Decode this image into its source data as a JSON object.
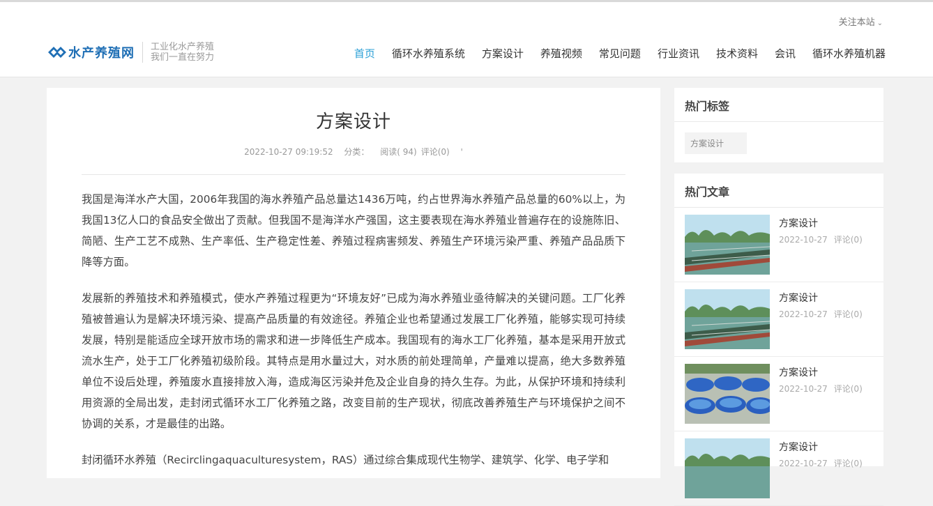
{
  "header": {
    "follow_label": "关注本站",
    "logo_name": "水产养殖网",
    "tagline_1": "工业化水产养殖",
    "tagline_2": "我们一直在努力",
    "nav": [
      "首页",
      "循环水养殖系统",
      "方案设计",
      "养殖视频",
      "常见问题",
      "行业资讯",
      "技术资料",
      "会讯",
      "循环水养殖机器"
    ]
  },
  "article": {
    "title": "方案设计",
    "date": "2022-10-27 09:19:52",
    "category_label": "分类：",
    "reads": "阅读( 94)",
    "comments": "评论(0)",
    "extra": "'",
    "paragraphs": [
      "我国是海洋水产大国，2006年我国的海水养殖产品总量达1436万吨，约占世界海水养殖产品总量的60%以上，为我国13亿人口的食品安全做出了贡献。但我国不是海洋水产强国，这主要表现在海水养殖业普遍存在的设施陈旧、简陋、生产工艺不成熟、生产率低、生产稳定性差、养殖过程病害频发、养殖生产环境污染严重、养殖产品品质下降等方面。",
      "发展新的养殖技术和养殖模式，使水产养殖过程更为“环境友好”已成为海水养殖业亟待解决的关键问题。工厂化养殖被普遍认为是解决环境污染、提高产品质量的有效途径。养殖企业也希望通过发展工厂化养殖，能够实现可持续发展，特别是能适应全球开放市场的需求和进一步降低生产成本。我国现有的海水工厂化养殖，基本是采用开放式流水生产，处于工厂化养殖初级阶段。其特点是用水量过大，对水质的前处理简单，产量难以提高，绝大多数养殖单位不设后处理，养殖废水直接排放入海，造成海区污染并危及企业自身的持久生存。为此，从保护环境和持续利用资源的全局出发，走封闭式循环水工厂化养殖之路，改变目前的生产现状，彻底改善养殖生产与环境保护之间不协调的关系，才是最佳的出路。",
      "封闭循环水养殖（Recirclingaquaculturesystem，RAS）通过综合集成现代生物学、建筑学、化学、电子学和"
    ]
  },
  "sidebar": {
    "tags_title": "热门标签",
    "tags": [
      "方案设计"
    ],
    "hot_title": "热门文章",
    "posts": [
      {
        "title": "方案设计",
        "date": "2022-10-27",
        "comments": "评论(0)",
        "image": "lake-cages-photo"
      },
      {
        "title": "方案设计",
        "date": "2022-10-27",
        "comments": "评论(0)",
        "image": "lake-cages-photo"
      },
      {
        "title": "方案设计",
        "date": "2022-10-27",
        "comments": "评论(0)",
        "image": "blue-tanks-photo"
      },
      {
        "title": "方案设计",
        "date": "2022-10-27",
        "comments": "评论(0)",
        "image": "lake-cages-photo"
      }
    ]
  }
}
